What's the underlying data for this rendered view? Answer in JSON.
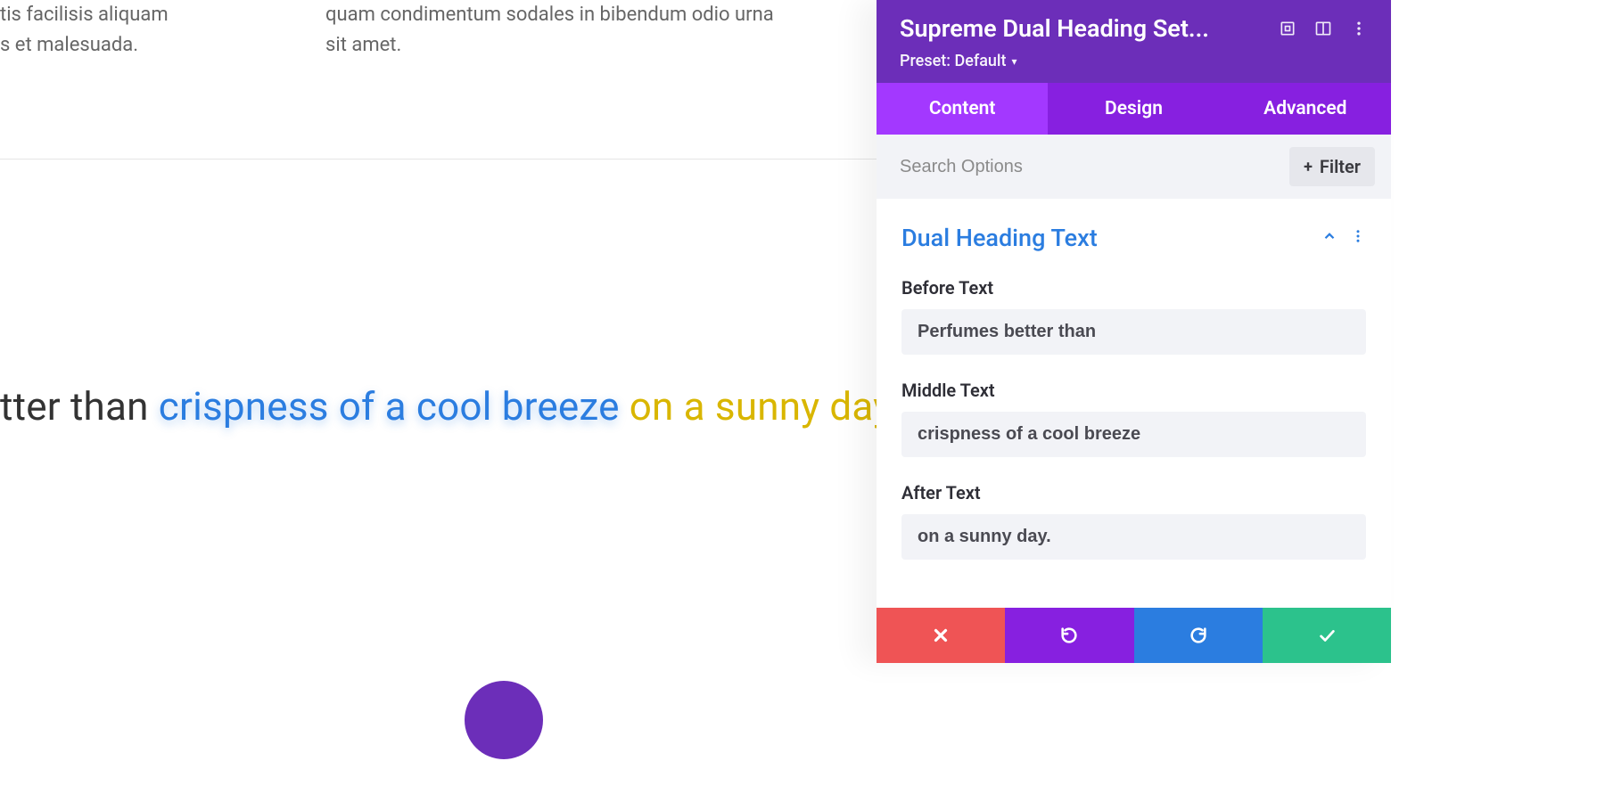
{
  "canvas": {
    "lorem_left": "tis facilisis aliquam s et malesuada.",
    "lorem_right": "quam condimentum sodales in bibendum odio urna sit amet.",
    "heading_before_display": "tter than ",
    "heading_middle_display": "crispness of a cool breeze",
    "heading_after_display": " on a sunny day."
  },
  "panel": {
    "title": "Supreme Dual Heading Set...",
    "preset_label": "Preset: Default",
    "tabs": {
      "content": "Content",
      "design": "Design",
      "advanced": "Advanced",
      "active": "content"
    },
    "search_placeholder": "Search Options",
    "filter_label": "Filter",
    "section": {
      "title": "Dual Heading Text",
      "fields": {
        "before": {
          "label": "Before Text",
          "value": "Perfumes better than"
        },
        "middle": {
          "label": "Middle Text",
          "value": "crispness of a cool breeze"
        },
        "after": {
          "label": "After Text",
          "value": "on a sunny day."
        }
      }
    }
  },
  "icons": {
    "expand": "expand-icon",
    "toggle_view": "toggle-view-icon",
    "kebab": "kebab-menu-icon",
    "chevron_up": "chevron-up-icon",
    "section_menu": "section-menu-icon",
    "plus": "+"
  },
  "footer": {
    "cancel": "cancel",
    "undo": "undo",
    "redo": "redo",
    "save": "save"
  },
  "colors": {
    "brand_purple_dark": "#6c2eb9",
    "brand_purple": "#8720e0",
    "brand_purple_light": "#a338ff",
    "accent_blue": "#2b7de0",
    "accent_yellow": "#d9b600",
    "cancel_red": "#ef5455",
    "save_green": "#2cc28c"
  }
}
